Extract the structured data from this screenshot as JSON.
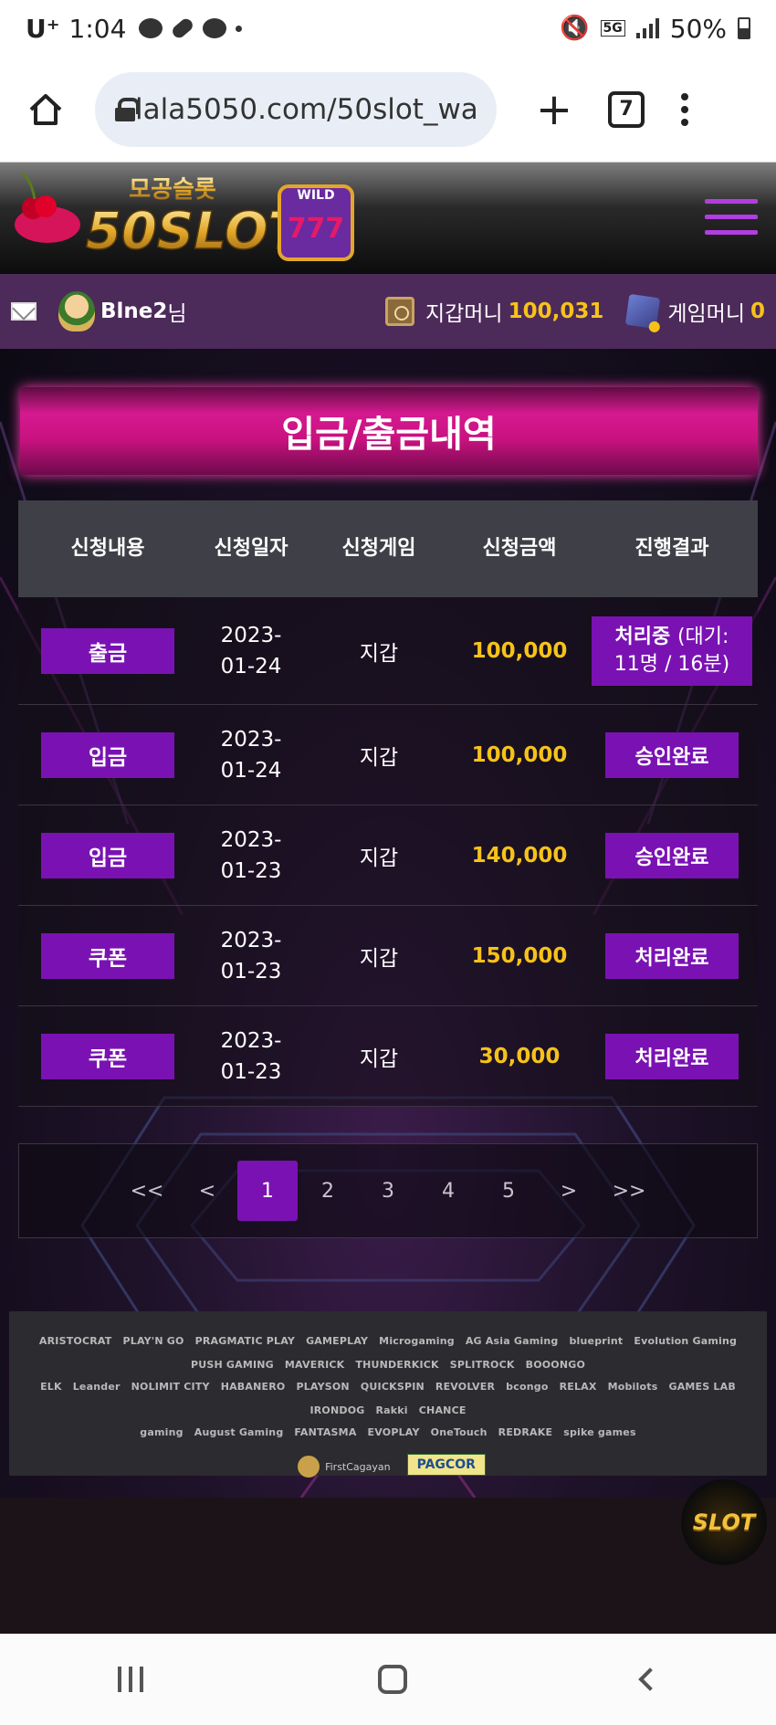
{
  "status_bar": {
    "carrier": "U⁺",
    "time": "1:04",
    "network": "5G",
    "battery": "50%"
  },
  "browser": {
    "url": "lala5050.com/50slot_wa",
    "tab_count": "7"
  },
  "site": {
    "logo_top": "모공슬롯",
    "logo_main": "50SLOT",
    "logo_reel": "777",
    "logo_wild": "WILD"
  },
  "userbar": {
    "user_name": "Blne2",
    "user_suffix": "님",
    "wallet_label": "지갑머니",
    "wallet_value": "100,031",
    "game_label": "게임머니",
    "game_value": "0"
  },
  "page": {
    "title": "입금/출금내역"
  },
  "table": {
    "headers": [
      "신청내용",
      "신청일자",
      "신청게임",
      "신청금액",
      "진행결과"
    ],
    "rows": [
      {
        "type": "출금",
        "date_line1": "2023-",
        "date_line2": "01-24",
        "game": "지갑",
        "amount": "100,000",
        "status": "처리중",
        "status_sub": "(대기:",
        "status_sub2": "11명 / 16분)"
      },
      {
        "type": "입금",
        "date_line1": "2023-",
        "date_line2": "01-24",
        "game": "지갑",
        "amount": "100,000",
        "status": "승인완료"
      },
      {
        "type": "입금",
        "date_line1": "2023-",
        "date_line2": "01-23",
        "game": "지갑",
        "amount": "140,000",
        "status": "승인완료"
      },
      {
        "type": "쿠폰",
        "date_line1": "2023-",
        "date_line2": "01-23",
        "game": "지갑",
        "amount": "150,000",
        "status": "처리완료"
      },
      {
        "type": "쿠폰",
        "date_line1": "2023-",
        "date_line2": "01-23",
        "game": "지갑",
        "amount": "30,000",
        "status": "처리완료"
      }
    ]
  },
  "pagination": {
    "first": "<<",
    "prev": "<",
    "pages": [
      "1",
      "2",
      "3",
      "4",
      "5"
    ],
    "next": ">",
    "last": ">>",
    "current": "1"
  },
  "partners": {
    "row1": [
      "ARISTOCRAT",
      "PLAY'N GO",
      "PRAGMATIC PLAY",
      "GAMEPLAY",
      "Microgaming",
      "AG Asia Gaming",
      "blueprint",
      "Evolution Gaming",
      "PUSH GAMING",
      "MAVERICK",
      "THUNDERKICK",
      "SPLITROCK",
      "BOOONGO"
    ],
    "row2": [
      "ELK",
      "Leander",
      "NOLIMIT CITY",
      "HABANERO",
      "PLAYSON",
      "QUICKSPIN",
      "REVOLVER",
      "bcongo",
      "RELAX",
      "Mobilots",
      "GAMES LAB",
      "IRONDOG",
      "Rakki",
      "CHANCE"
    ],
    "row3": [
      "gaming",
      "August Gaming",
      "FANTASMA",
      "EVOPLAY",
      "OneTouch",
      "REDRAKE",
      "spike games"
    ],
    "badge1": "FirstCagayan",
    "badge2": "PAGCOR"
  },
  "floating_logo": "SLOT"
}
